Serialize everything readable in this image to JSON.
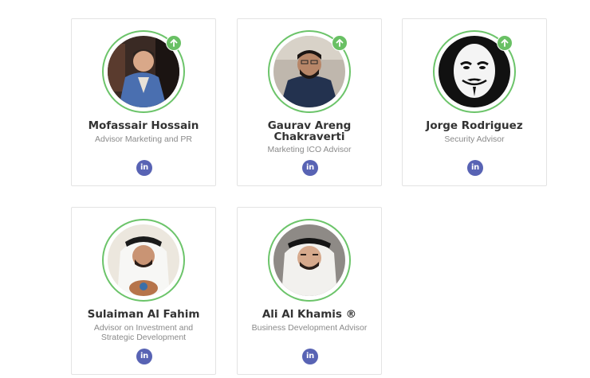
{
  "team": {
    "members": [
      {
        "name": "Mofassair Hossain",
        "role": "Advisor Marketing and PR",
        "badge": "up-arrow-icon",
        "social": "linkedin-icon",
        "social_label": "in"
      },
      {
        "name": "Gaurav Areng Chakraverti",
        "role": "Marketing ICO Advisor",
        "badge": "up-arrow-icon",
        "social": "linkedin-icon",
        "social_label": "in"
      },
      {
        "name": "Jorge Rodriguez",
        "role": "Security Advisor",
        "badge": "up-arrow-icon",
        "social": "linkedin-icon",
        "social_label": "in"
      },
      {
        "name": "Sulaiman Al Fahim",
        "role": "Advisor on Investment and Strategic Development",
        "social": "linkedin-icon",
        "social_label": "in"
      },
      {
        "name": "Ali Al Khamis ®",
        "role": "Business Development Advisor",
        "social": "linkedin-icon",
        "social_label": "in"
      }
    ]
  },
  "colors": {
    "ring": "#6cc46a",
    "badge": "#69c064",
    "linkedin": "#5863b4",
    "name": "#333333",
    "role": "#8a8a8a"
  }
}
